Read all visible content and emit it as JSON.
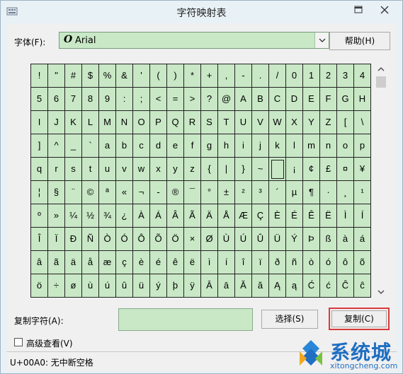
{
  "window": {
    "title": "字符映射表"
  },
  "font": {
    "label": "字体(F):",
    "value": "Arial",
    "font_icon_glyph": "O"
  },
  "buttons": {
    "help": "帮助(H)",
    "select": "选择(S)",
    "copy": "复制(C)"
  },
  "grid": {
    "rows": [
      [
        "!",
        "\"",
        "#",
        "$",
        "%",
        "&",
        "'",
        "(",
        ")",
        "*",
        "+",
        ",",
        "-",
        ".",
        "/",
        "0",
        "1",
        "2",
        "3",
        "4"
      ],
      [
        "5",
        "6",
        "7",
        "8",
        "9",
        ":",
        ";",
        "<",
        "=",
        ">",
        "?",
        "@",
        "A",
        "B",
        "C",
        "D",
        "E",
        "F",
        "G",
        "H"
      ],
      [
        "I",
        "J",
        "K",
        "L",
        "M",
        "N",
        "O",
        "P",
        "Q",
        "R",
        "S",
        "T",
        "U",
        "V",
        "W",
        "X",
        "Y",
        "Z",
        "[",
        "\\"
      ],
      [
        "]",
        "^",
        "_",
        "`",
        "a",
        "b",
        "c",
        "d",
        "e",
        "f",
        "g",
        "h",
        "i",
        "j",
        "k",
        "l",
        "m",
        "n",
        "o",
        "p"
      ],
      [
        "q",
        "r",
        "s",
        "t",
        "u",
        "v",
        "w",
        "x",
        "y",
        "z",
        "{",
        "|",
        "}",
        "~",
        "",
        "¡",
        "¢",
        "£",
        "¤",
        "¥"
      ],
      [
        "¦",
        "§",
        "¨",
        "©",
        "ª",
        "«",
        "¬",
        "-",
        "®",
        "¯",
        "°",
        "±",
        "²",
        "³",
        "´",
        "µ",
        "¶",
        "·",
        "¸",
        "¹"
      ],
      [
        "º",
        "»",
        "¼",
        "½",
        "¾",
        "¿",
        "À",
        "Á",
        "Â",
        "Ã",
        "Ä",
        "Å",
        "Æ",
        "Ç",
        "È",
        "É",
        "Ê",
        "Ë",
        "Ì",
        "Í"
      ],
      [
        "Î",
        "Ï",
        "Ð",
        "Ñ",
        "Ò",
        "Ó",
        "Ô",
        "Õ",
        "Ö",
        "×",
        "Ø",
        "Ù",
        "Ú",
        "Û",
        "Ü",
        "Ý",
        "Þ",
        "ß",
        "à",
        "á"
      ],
      [
        "â",
        "ã",
        "ä",
        "å",
        "æ",
        "ç",
        "è",
        "é",
        "ê",
        "ë",
        "ì",
        "í",
        "î",
        "ï",
        "ð",
        "ñ",
        "ò",
        "ó",
        "ô",
        "õ"
      ],
      [
        "ö",
        "÷",
        "ø",
        "ù",
        "ú",
        "û",
        "ü",
        "ý",
        "þ",
        "ÿ",
        "Ā",
        "ā",
        "Ă",
        "ă",
        "Ą",
        "ą",
        "Ć",
        "ć",
        "Ĉ",
        "ĉ"
      ]
    ],
    "selected": {
      "row": 4,
      "col": 14
    }
  },
  "copy": {
    "label": "复制字符(A):",
    "value": ""
  },
  "advanced": {
    "label": "高级查看(V)",
    "checked": false
  },
  "status": {
    "text": "U+00A0: 无中断空格"
  },
  "watermark": {
    "name": "系统城",
    "url": "xitongcheng.com"
  },
  "colors": {
    "cell_bg": "#c9e8c6",
    "highlight": "#d93a3a",
    "brand": "#1f6fc2"
  },
  "icons": {
    "app": "character-map-icon",
    "restore": "restore-icon",
    "close": "close-icon",
    "dropdown": "chevron-down-icon",
    "scroll_up": "arrow-up-icon",
    "scroll_down": "arrow-down-icon"
  }
}
